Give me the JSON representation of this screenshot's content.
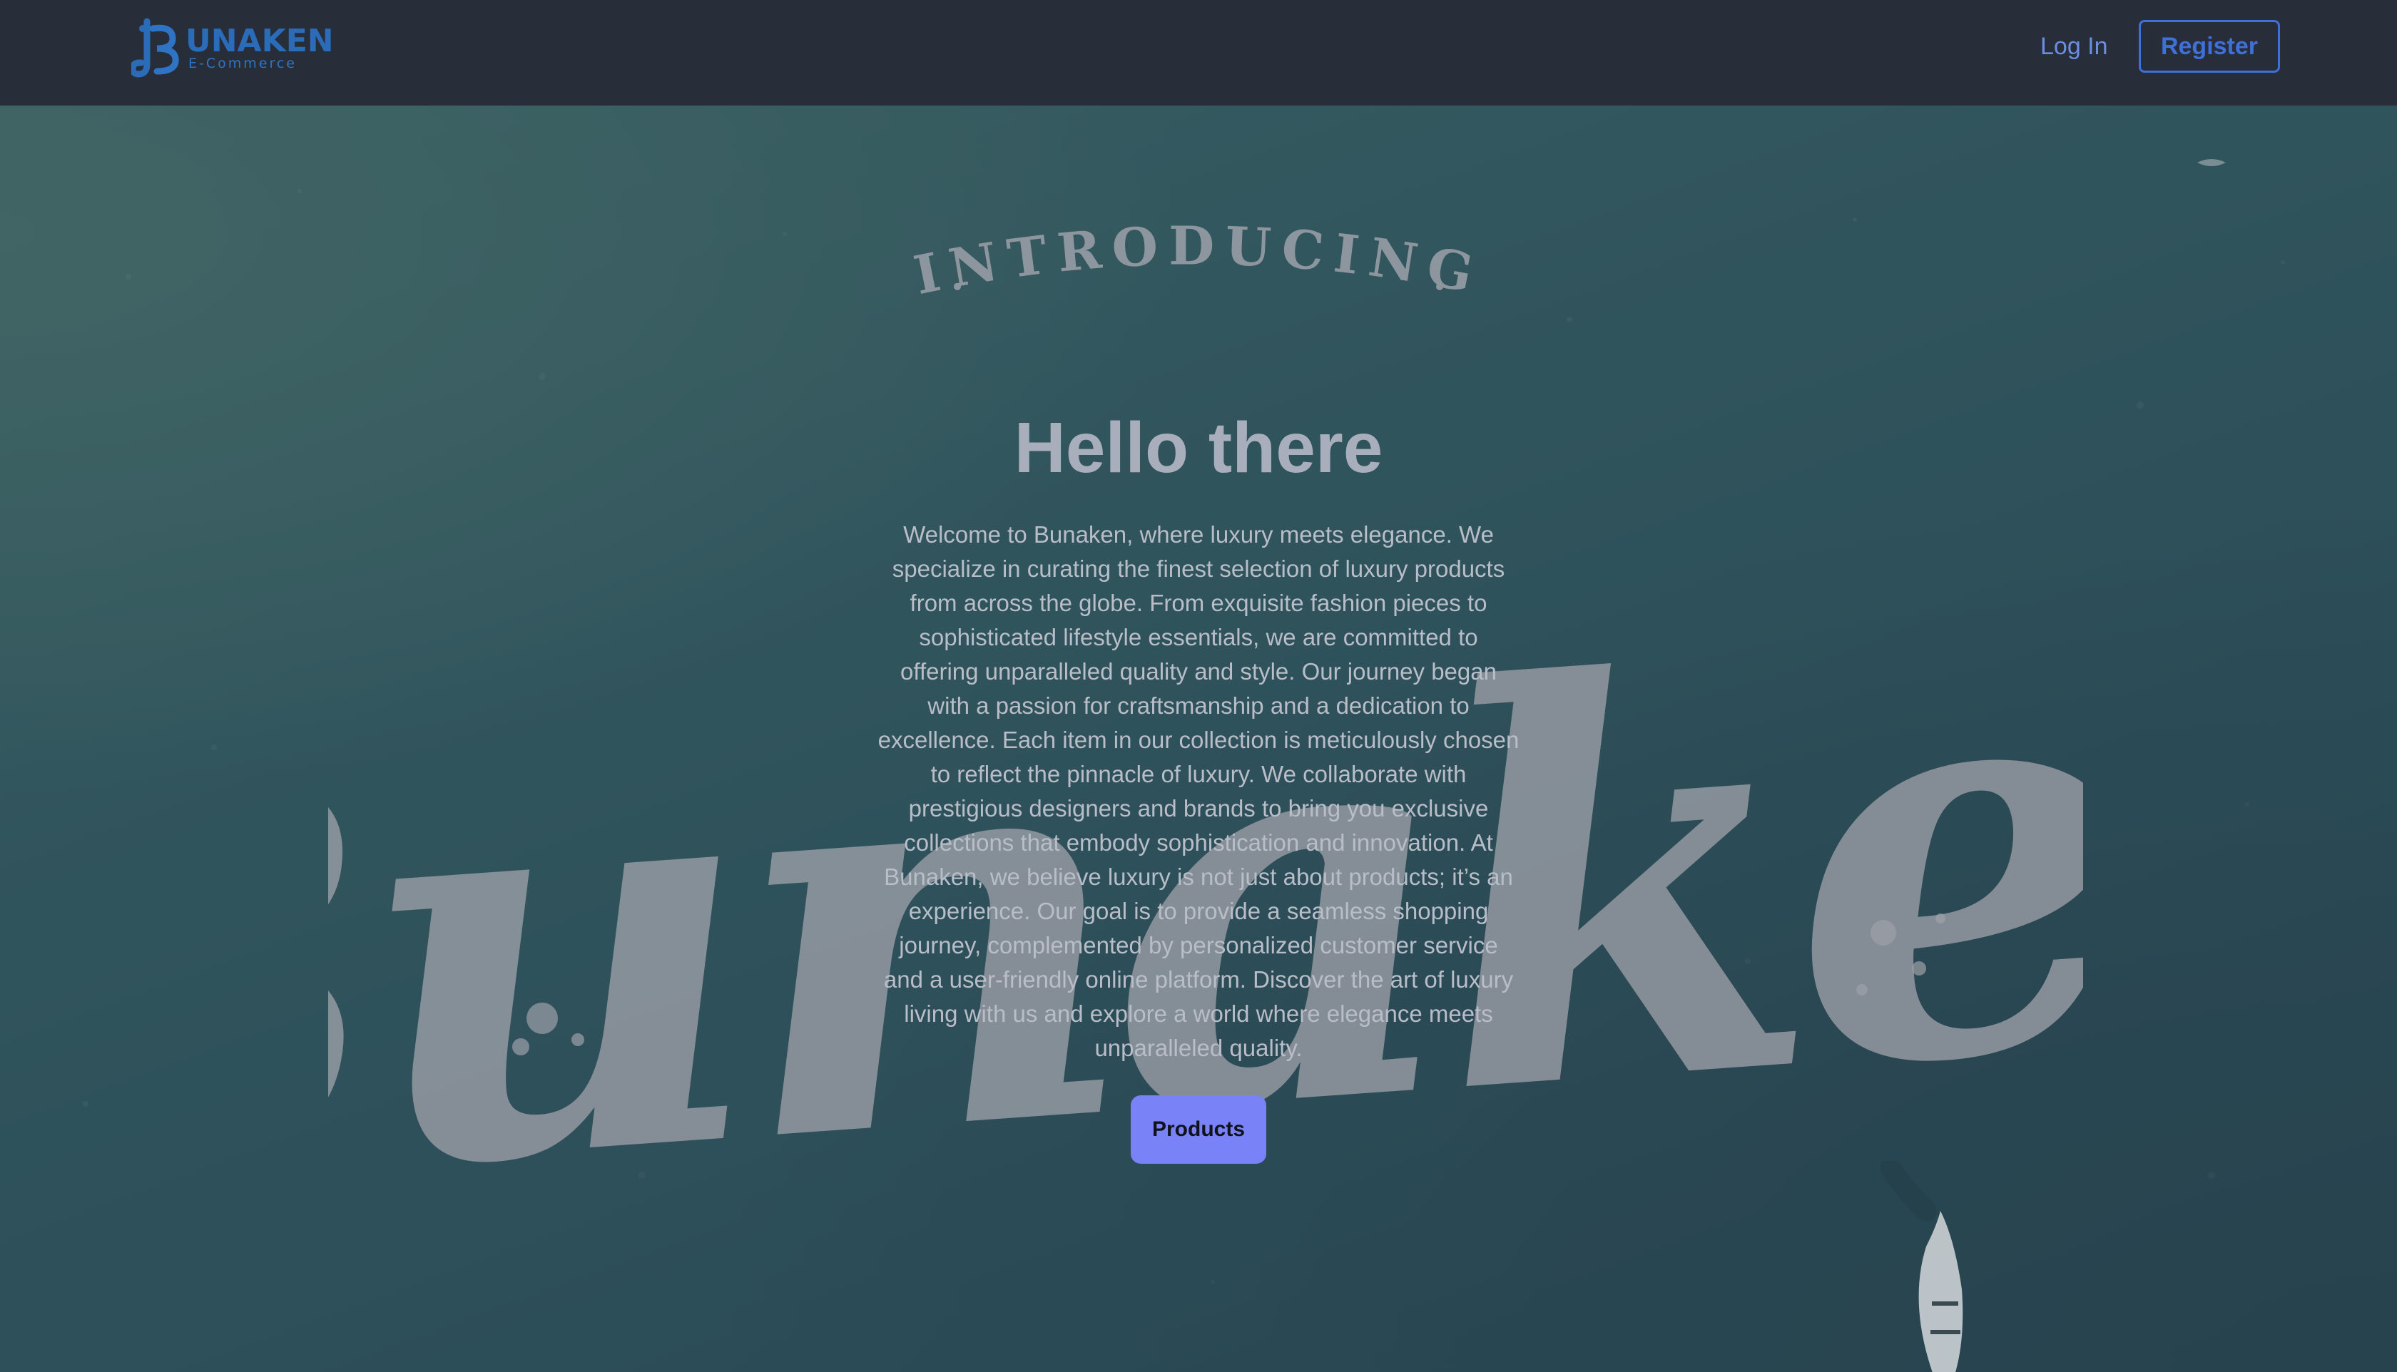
{
  "brand": {
    "name": "UNAKEN",
    "subtitle": "E-Commerce",
    "color": "#2b6cb9"
  },
  "nav": {
    "login_label": "Log In",
    "register_label": "Register"
  },
  "hero": {
    "eyebrow": "INTRODUCING",
    "script_word": "Bunaken",
    "title": "Hello there",
    "description": "Welcome to Bunaken, where luxury meets elegance. We specialize in curating the finest selection of luxury products from across the globe. From exquisite fashion pieces to sophisticated lifestyle essentials, we are committed to offering unparalleled quality and style. Our journey began with a passion for craftsmanship and a dedication to excellence. Each item in our collection is meticulously chosen to reflect the pinnacle of luxury. We collaborate with prestigious designers and brands to bring you exclusive collections that embody sophistication and innovation. At Bunaken, we believe luxury is not just about products; it’s an experience. Our goal is to provide a seamless shopping journey, complemented by personalized customer service and a user-friendly online platform. Discover the art of luxury living with us and explore a world where elegance meets unparalleled quality.",
    "cta_label": "Products"
  },
  "colors": {
    "navbar_bg": "#282e39",
    "accent": "#7a82f7",
    "link": "#6b8fe0",
    "register_border": "#3f6fd8",
    "hero_bg": "#355e66"
  }
}
